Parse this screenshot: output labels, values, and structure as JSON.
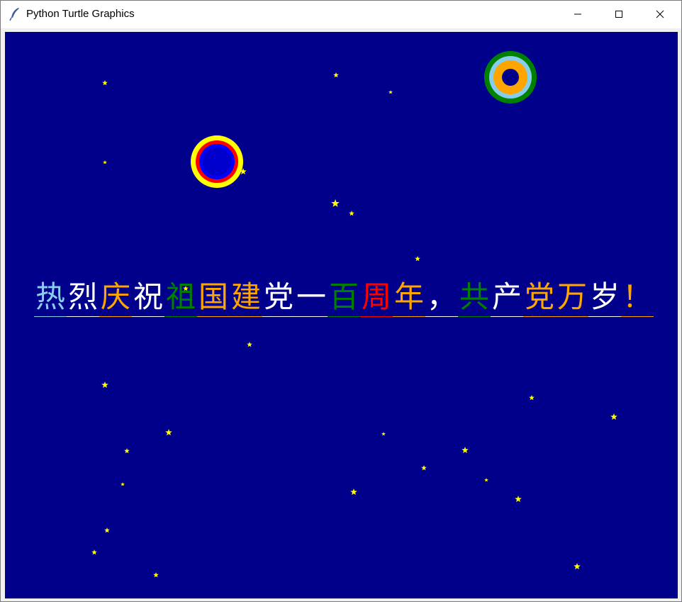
{
  "window": {
    "title": "Python Turtle Graphics",
    "icon": "feather-icon",
    "controls": {
      "minimize": "minimize-icon",
      "maximize": "maximize-icon",
      "close": "close-icon"
    }
  },
  "colors": {
    "canvas_background": "#00008b",
    "star": "#ffff00",
    "ring1": [
      "#ffff00",
      "#ff0000",
      "#0000ff"
    ],
    "ring2": [
      "#008000",
      "#87ceeb",
      "#ffa500",
      "#00008b"
    ]
  },
  "banner": {
    "chars": [
      {
        "text": "热",
        "color": "#87ceeb"
      },
      {
        "text": "烈",
        "color": "#ffffff"
      },
      {
        "text": "庆",
        "color": "#ffa500"
      },
      {
        "text": "祝",
        "color": "#ffffff"
      },
      {
        "text": "祖",
        "color": "#008000"
      },
      {
        "text": "国",
        "color": "#ffa500"
      },
      {
        "text": "建",
        "color": "#ffa500"
      },
      {
        "text": "党",
        "color": "#ffffff"
      },
      {
        "text": "一",
        "color": "#ffffff"
      },
      {
        "text": "百",
        "color": "#008000"
      },
      {
        "text": "周",
        "color": "#ff0000"
      },
      {
        "text": "年",
        "color": "#ffa500"
      },
      {
        "text": "，",
        "color": "#ffffff"
      },
      {
        "text": "共",
        "color": "#008000"
      },
      {
        "text": "产",
        "color": "#ffffff"
      },
      {
        "text": "党",
        "color": "#ffa500"
      },
      {
        "text": "万",
        "color": "#ffa500"
      },
      {
        "text": "岁",
        "color": "#ffffff"
      },
      {
        "text": "！",
        "color": "#ffa500"
      }
    ]
  }
}
